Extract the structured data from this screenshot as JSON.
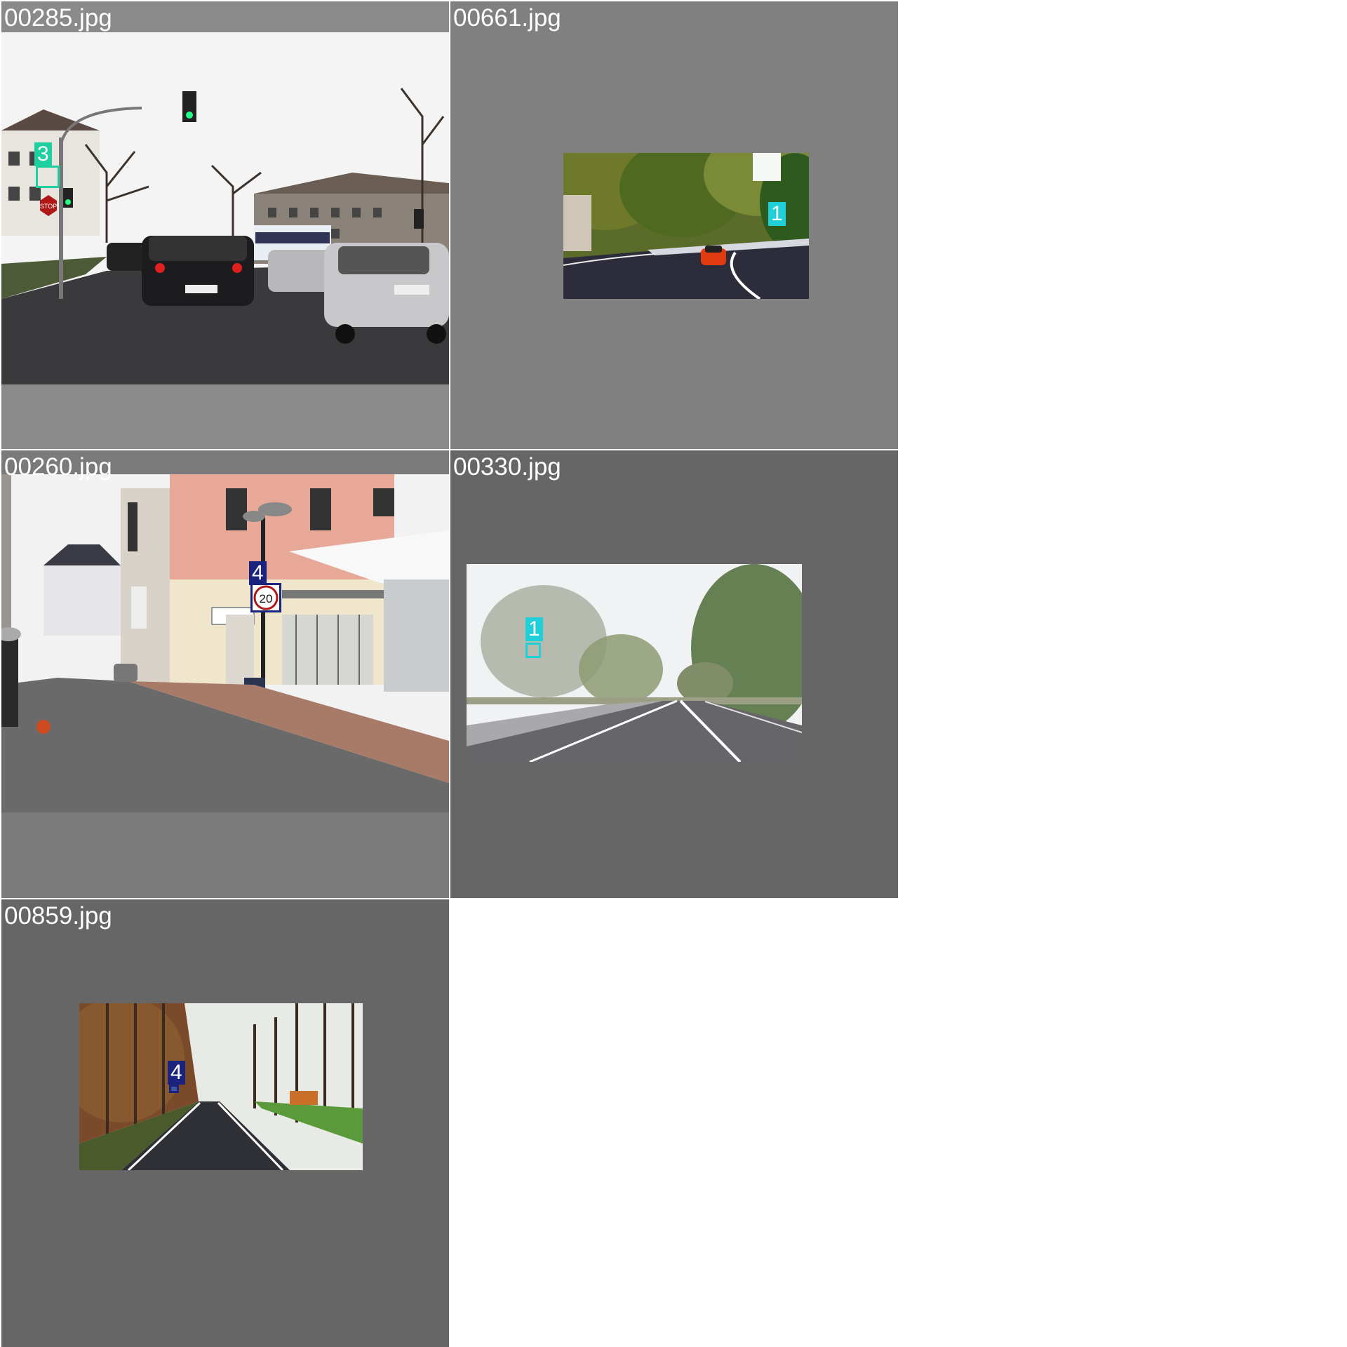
{
  "tiles": [
    {
      "filename": "00285.jpg",
      "label": "3",
      "label_color": "#1ecfa0",
      "background": "#8a8a8a"
    },
    {
      "filename": "00661.jpg",
      "label": "1",
      "label_color": "#1fd0d8",
      "background": "#808080"
    },
    {
      "filename": "00260.jpg",
      "label": "4",
      "label_color": "#1a237e",
      "background": "#7a7a7a"
    },
    {
      "filename": "00330.jpg",
      "label": "1",
      "label_color": "#1fd0d8",
      "background": "#666666"
    },
    {
      "filename": "00859.jpg",
      "label": "4",
      "label_color": "#1a237e",
      "background": "#666666"
    }
  ],
  "signs": {
    "stop": "STOP",
    "speed": "20"
  }
}
